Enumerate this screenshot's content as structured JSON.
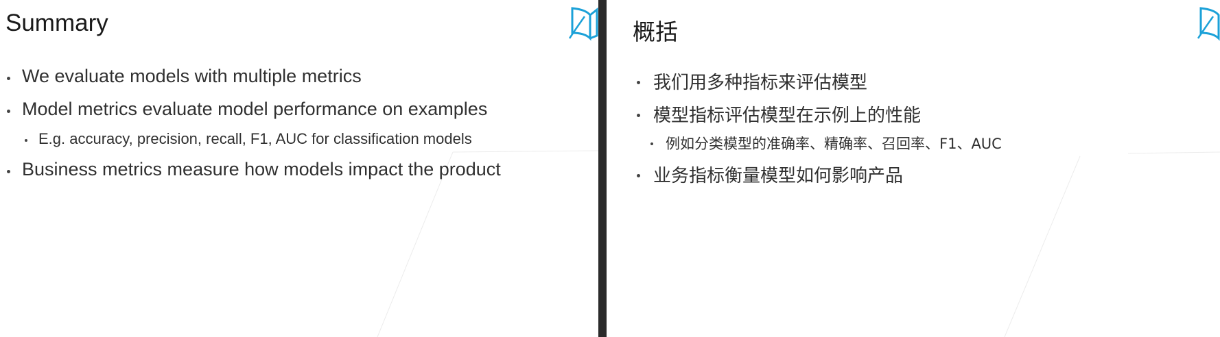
{
  "left_slide": {
    "title": "Summary",
    "logo_icon": "book-logo-icon",
    "bullets": [
      {
        "level": 1,
        "text": "We evaluate models with multiple metrics"
      },
      {
        "level": 1,
        "text": "Model metrics evaluate model performance on examples"
      },
      {
        "level": 2,
        "text": "E.g. accuracy, precision, recall, F1, AUC for classification models"
      },
      {
        "level": 1,
        "text": "Business metrics measure how models impact the product"
      }
    ]
  },
  "right_slide": {
    "title": "概括",
    "logo_icon": "book-logo-icon",
    "bullets": [
      {
        "level": 1,
        "text": "我们用多种指标来评估模型"
      },
      {
        "level": 1,
        "text": "模型指标评估模型在示例上的性能"
      },
      {
        "level": 2,
        "text": "例如分类模型的准确率、精确率、召回率、F1、AUC"
      },
      {
        "level": 1,
        "text": "业务指标衡量模型如何影响产品"
      }
    ]
  },
  "colors": {
    "logo_accent": "#1ba1d8",
    "divider": "#2b2b2b",
    "text": "#303030"
  }
}
